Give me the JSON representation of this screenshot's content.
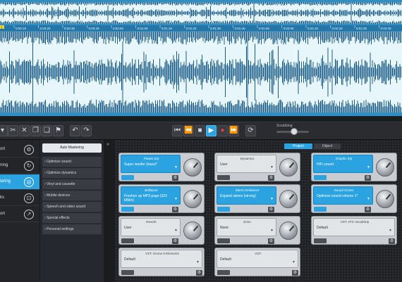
{
  "waveform": {
    "timeline": [
      "0:00:10",
      "0:00:20",
      "0:00:30",
      "0:00:40",
      "0:00:50",
      "0:01:00",
      "0:01:10",
      "0:01:20",
      "0:01:30",
      "0:01:40",
      "0:01:50",
      "0:02:00",
      "0:02:10",
      "0:02:20",
      "0:02:30",
      "0:02:40"
    ],
    "marker": "1",
    "colors": {
      "background": "#2d8fc4",
      "wave": "#1a5b86",
      "highlight": "#e7f6fb"
    }
  },
  "toolbar": {
    "edit_icons": [
      "scissors-icon",
      "close-icon",
      "copy-icon",
      "paste-icon",
      "flag-icon",
      "undo-icon",
      "redo-icon"
    ],
    "transport_icons": [
      "skip-start-icon",
      "prev-icon",
      "stop-icon",
      "play-icon",
      "record-icon",
      "next-icon",
      "loop-icon"
    ],
    "scrubbing_label": "Scrubbing"
  },
  "nav": {
    "items": [
      {
        "label": "ort",
        "icon": "gear-icon"
      },
      {
        "label": "ning",
        "icon": "refresh-icon"
      },
      {
        "label": "tering",
        "icon": "target-icon",
        "active": true
      },
      {
        "label": "ks",
        "icon": "badge-icon"
      },
      {
        "label": "ort",
        "icon": "share-icon"
      }
    ]
  },
  "sub": {
    "auto_label": "Auto Mastering",
    "items": [
      "› Optimize sound",
      "› Optimize dynamics",
      "› Vinyl and cassette",
      "› Mobile devices",
      "› Speech and video sound",
      "› Special effects",
      "› Personal settings"
    ]
  },
  "main": {
    "collapse": "«",
    "tabs": {
      "project": "Project",
      "object": "Object"
    },
    "cards": [
      {
        "title": "Param EQ",
        "value": "Super woofer (bass)*",
        "active": true
      },
      {
        "title": "Dynamics",
        "value": "User",
        "active": false
      },
      {
        "title": "Graphic EQ",
        "value": "HiFi sound",
        "active": true
      },
      {
        "title": "Brilliance",
        "value": "Freshen up MP3 page (320 kBit/s)",
        "active": true
      },
      {
        "title": "Stereo Enhancer",
        "value": "Expand stereo (strong)",
        "active": true
      },
      {
        "title": "Sound Cloner",
        "value": "Optimize sound volume 1*",
        "active": true
      },
      {
        "title": "Reverb",
        "value": "User",
        "active": false
      },
      {
        "title": "Echo",
        "value": "None",
        "active": false
      },
      {
        "title": "VST: eTX VocalStrip",
        "value": "Default",
        "active": false,
        "wide": true
      },
      {
        "title": "VST: Ozone 8 Elements",
        "value": "Default",
        "active": false,
        "wide": true
      },
      {
        "title": "VST:",
        "value": "Default",
        "active": false,
        "wide": true
      }
    ]
  }
}
